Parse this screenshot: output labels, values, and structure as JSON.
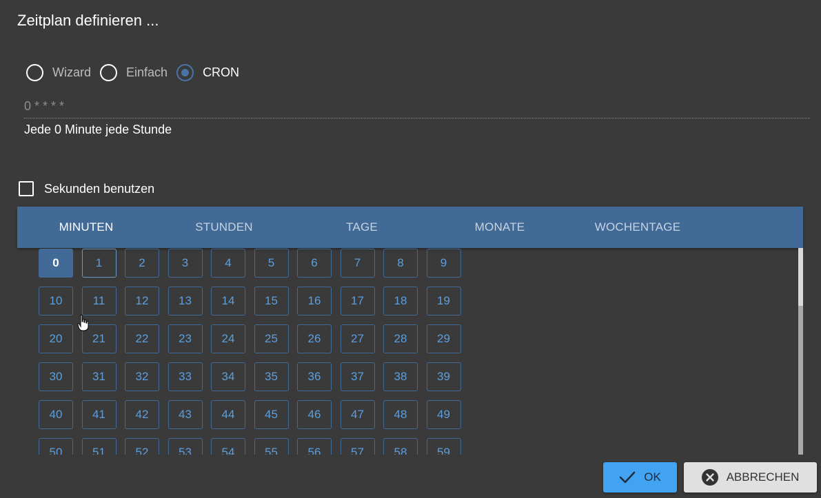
{
  "dialog": {
    "title": "Zeitplan definieren ..."
  },
  "mode": {
    "options": [
      {
        "label": "Wizard",
        "checked": false
      },
      {
        "label": "Einfach",
        "checked": false
      },
      {
        "label": "CRON",
        "checked": true
      }
    ]
  },
  "cron": {
    "value": "0 * * * *",
    "description": "Jede 0 Minute jede Stunde"
  },
  "seconds": {
    "label": "Sekunden benutzen",
    "checked": false
  },
  "tabs": [
    {
      "label": "MINUTEN",
      "active": true
    },
    {
      "label": "STUNDEN",
      "active": false
    },
    {
      "label": "TAGE",
      "active": false
    },
    {
      "label": "MONATE",
      "active": false
    },
    {
      "label": "WOCHENTAGE",
      "active": false
    }
  ],
  "minutes": {
    "selected": [
      0
    ],
    "values": [
      "0",
      "1",
      "2",
      "3",
      "4",
      "5",
      "6",
      "7",
      "8",
      "9",
      "10",
      "11",
      "12",
      "13",
      "14",
      "15",
      "16",
      "17",
      "18",
      "19",
      "20",
      "21",
      "22",
      "23",
      "24",
      "25",
      "26",
      "27",
      "28",
      "29",
      "30",
      "31",
      "32",
      "33",
      "34",
      "35",
      "36",
      "37",
      "38",
      "39",
      "40",
      "41",
      "42",
      "43",
      "44",
      "45",
      "46",
      "47",
      "48",
      "49",
      "50",
      "51",
      "52",
      "53",
      "54",
      "55",
      "56",
      "57",
      "58",
      "59"
    ]
  },
  "buttons": {
    "ok": {
      "label": "OK",
      "icon": "check-icon"
    },
    "cancel": {
      "label": "ABBRECHEN",
      "icon": "close-circle-icon"
    }
  },
  "colors": {
    "accent": "#426a97",
    "ok_button": "#41a3f2",
    "minute_text": "#5b9fe0"
  }
}
